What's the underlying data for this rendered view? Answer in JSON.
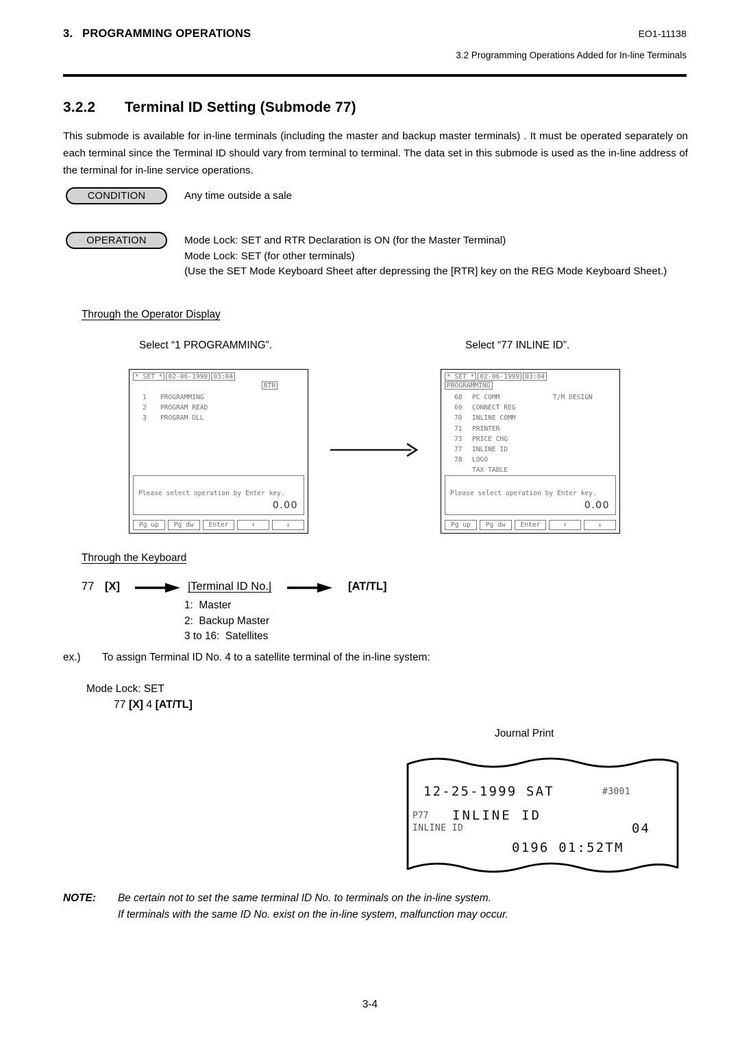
{
  "header": {
    "chapter_number": "3.",
    "chapter_title": "PROGRAMMING OPERATIONS",
    "doc_code": "EO1-11138",
    "section_ref": "3.2  Programming Operations Added for In-line Terminals"
  },
  "section": {
    "number": "3.2.2",
    "title": "Terminal ID Setting (Submode 77)",
    "intro": "This submode is available for in-line terminals (including the master and backup master terminals) . It must be operated separately on each terminal since the Terminal ID should vary from terminal to terminal. The data set in this submode is used as the in-line address of the terminal for in-line service operations."
  },
  "condition": {
    "badge_label": "CONDITION",
    "text": "Any time outside a sale"
  },
  "operation": {
    "badge_label": "OPERATION",
    "line1": "Mode Lock:  SET and RTR Declaration is ON (for the Master Terminal)",
    "line2": "Mode Lock:  SET (for other terminals)",
    "line3": "(Use the SET Mode Keyboard Sheet after depressing the [RTR] key on the REG Mode Keyboard Sheet.)"
  },
  "operator_display": {
    "subhead": "Through the Operator Display",
    "caption_left": "Select “1 PROGRAMMING”.",
    "caption_right": "Select “77 INLINE ID”.",
    "left_panel": {
      "mode": "* SET *",
      "date": "02-06-1999",
      "time": "03:04",
      "rtr_tag": "RTR",
      "menu": [
        {
          "num": "1",
          "label": "PROGRAMMING",
          "aux": ""
        },
        {
          "num": "2",
          "label": "PROGRAM READ",
          "aux": ""
        },
        {
          "num": "3",
          "label": "PROGRAM DLL",
          "aux": ""
        }
      ],
      "message": "Please select operation by Enter key.",
      "amount": "0.00",
      "keys": [
        "Pg up",
        "Pg dw",
        "Enter",
        "↑",
        "↓"
      ]
    },
    "right_panel": {
      "mode": "* SET *",
      "date": "02-06-1999",
      "time": "03:04",
      "mode_tag": "PROGRAMMING",
      "menu": [
        {
          "num": "68",
          "label": "PC COMM",
          "aux": "T/M DESIGN"
        },
        {
          "num": "69",
          "label": "CONNECT REG",
          "aux": ""
        },
        {
          "num": "70",
          "label": "INLINE COMM",
          "aux": ""
        },
        {
          "num": "71",
          "label": "PRINTER",
          "aux": ""
        },
        {
          "num": "73",
          "label": "PRICE CHG",
          "aux": ""
        },
        {
          "num": "77",
          "label": "INLINE ID",
          "aux": ""
        },
        {
          "num": "78",
          "label": "LOGO",
          "aux": ""
        },
        {
          "num": "",
          "label": "TAX TABLE",
          "aux": ""
        }
      ],
      "message": "Please select operation by Enter key.",
      "amount": "0.00",
      "keys": [
        "Pg up",
        "Pg dw",
        "Enter",
        "↑",
        "↓"
      ]
    }
  },
  "keyboard": {
    "subhead": "Through the Keyboard",
    "prefix": "77",
    "x_key": "[X]",
    "terminal_id_field": "|Terminal ID No.|",
    "attl_key": "[AT/TL]",
    "id_options": [
      "1:  Master",
      "2:  Backup Master",
      "3 to 16:  Satellites"
    ]
  },
  "example": {
    "label": "ex.)",
    "text": "To assign Terminal ID No. 4 to a satellite terminal of the in-line system:",
    "mode_lock": "Mode Lock:  SET",
    "keys_prefix": "77 ",
    "keys_x": "[X]",
    "keys_value": " 4 ",
    "keys_attl": "[AT/TL]"
  },
  "journal": {
    "caption": "Journal Print",
    "date_line": "12-25-1999 SAT",
    "receipt_no": "#3001",
    "program_code": "P77",
    "program_title": "INLINE ID",
    "item_label": "INLINE ID",
    "item_value": "04",
    "footer": "0196 01:52TM"
  },
  "note": {
    "label": "NOTE:",
    "line1": "Be certain not to set the same terminal ID No. to terminals on the in-line system.",
    "line2": "If terminals with the same ID No. exist on the in-line system, malfunction may occur."
  },
  "footer": {
    "page_number": "3-4"
  }
}
